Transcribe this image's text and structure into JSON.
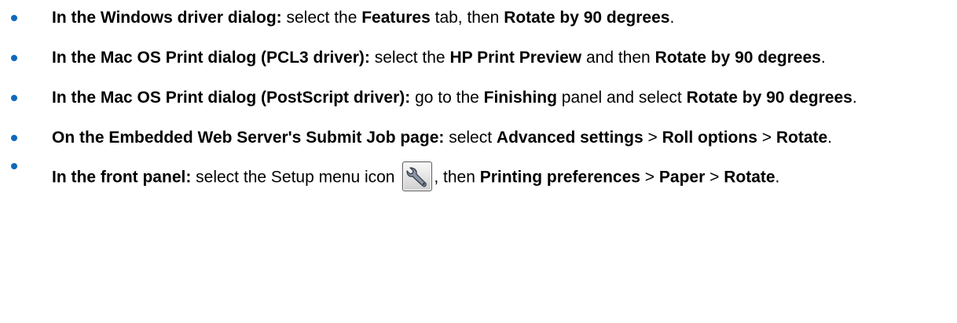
{
  "items": [
    {
      "lead": "In the Windows driver dialog:",
      "t1": " select the ",
      "b1": "Features",
      "t2": " tab, then ",
      "b2": "Rotate by 90 degrees",
      "t3": "."
    },
    {
      "lead": "In the Mac OS Print dialog (PCL3 driver):",
      "t1": " select the ",
      "b1": "HP Print Preview",
      "t2": " and then ",
      "b2": "Rotate by 90 degrees",
      "t3": "."
    },
    {
      "lead": "In the Mac OS Print dialog (PostScript driver):",
      "t1": " go to the ",
      "b1": "Finishing",
      "t2": " panel and select ",
      "b2": "Rotate by 90 degrees",
      "t3": "."
    },
    {
      "lead": "On the Embedded Web Server's Submit Job page:",
      "t1": " select ",
      "b1": "Advanced settings",
      "t2": " > ",
      "b2": "Roll options",
      "t3": " > ",
      "b3": "Rotate",
      "t4": "."
    },
    {
      "lead": "In the front panel:",
      "t1": " select the Setup menu icon ",
      "icon": "wrench-icon",
      "t2": ", then ",
      "b1": "Printing preferences",
      "t3": " > ",
      "b2": "Paper",
      "t4": " > ",
      "b3": "Rotate",
      "t5": "."
    }
  ],
  "colors": {
    "bullet": "#0d6ab8"
  }
}
